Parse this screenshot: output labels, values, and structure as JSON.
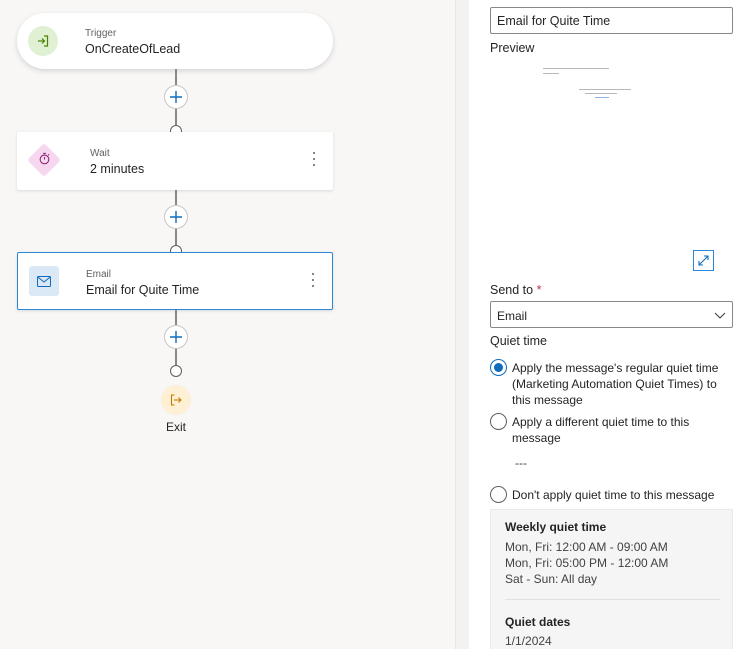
{
  "journey": {
    "trigger": {
      "kind": "Trigger",
      "title": "OnCreateOfLead",
      "icon": "trigger-enter-icon"
    },
    "wait": {
      "kind": "Wait",
      "title": "2 minutes",
      "icon": "timer-icon"
    },
    "email": {
      "kind": "Email",
      "title": "Email for Quite Time",
      "icon": "envelope-icon"
    },
    "exit_label": "Exit"
  },
  "panel": {
    "name_value": "Email for Quite Time",
    "preview_label": "Preview",
    "send_to_label": "Send to",
    "send_to_required": "*",
    "send_to_value": "Email",
    "quiet_time_label": "Quiet time",
    "options": [
      {
        "label": "Apply the message's regular quiet time (Marketing Automation Quiet Times) to this message",
        "checked": true
      },
      {
        "label": "Apply a different quiet time to this message",
        "checked": false
      },
      {
        "label": "Don't apply quiet time to this message",
        "checked": false
      }
    ],
    "different_value": "---",
    "weekly_title": "Weekly quiet time",
    "weekly_lines": [
      "Mon, Fri: 12:00 AM - 09:00 AM",
      "Mon, Fri: 05:00 PM - 12:00 AM",
      "Sat - Sun: All day"
    ],
    "dates_title": "Quiet dates",
    "dates_value": "1/1/2024"
  },
  "colors": {
    "accent": "#0f6cbd",
    "selected_border": "#2b88d8",
    "required": "#c4314b"
  }
}
